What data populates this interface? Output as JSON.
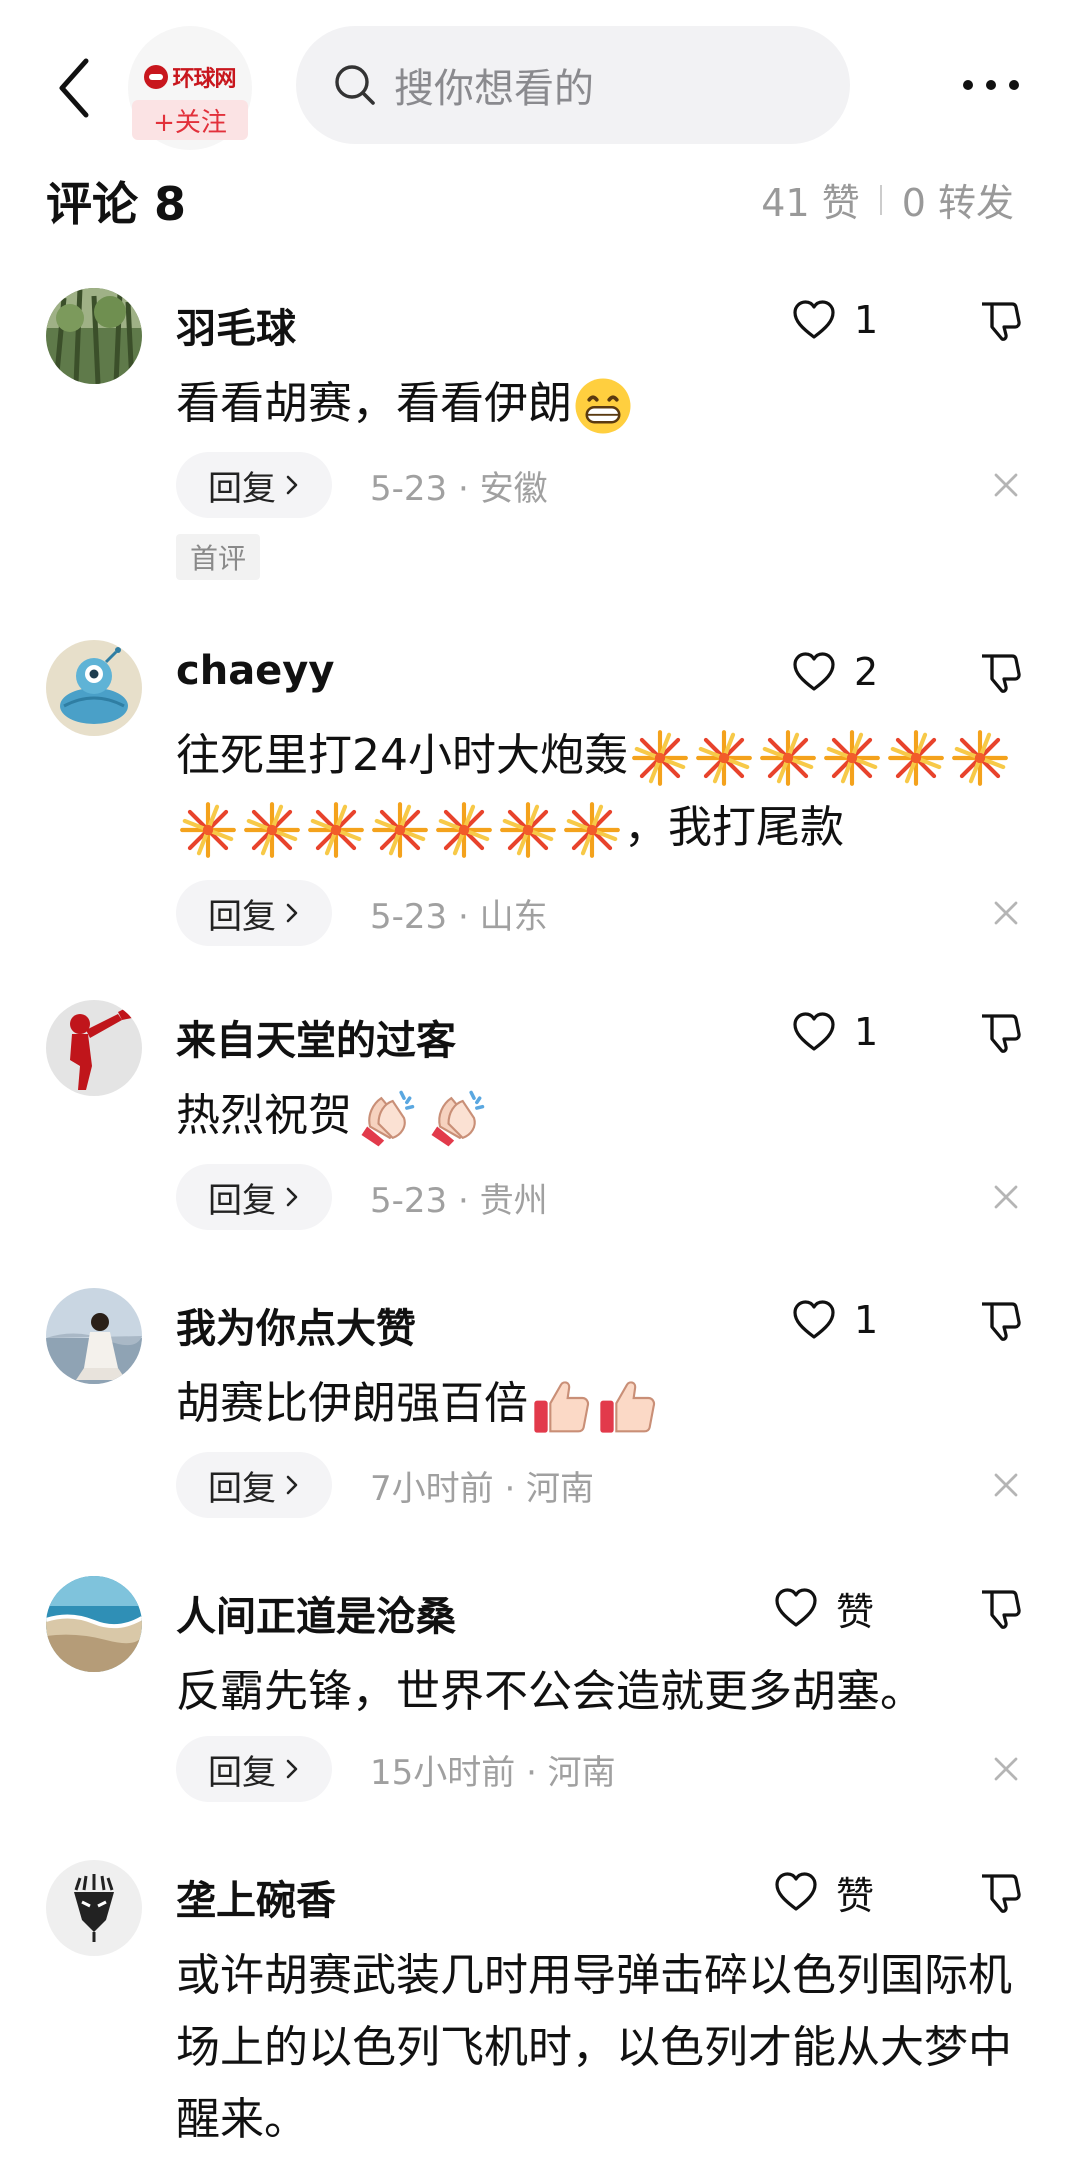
{
  "header": {
    "source_logo_text": "环球网",
    "follow_label": "+关注",
    "search_placeholder": "搜你想看的"
  },
  "comments_header": {
    "title": "评论 8",
    "likes": "41 赞",
    "reposts": "0 转发"
  },
  "comments": [
    {
      "username": "羽毛球",
      "likes": "1",
      "text": "看看胡赛，看看伊朗",
      "reply_label": "回复",
      "time_location": "5-23 · 安徽",
      "badge": "首评"
    },
    {
      "username": "chaeyy",
      "likes": "2",
      "text": "往死里打24小时大炮轰",
      "text_tail": "，我打尾款",
      "reply_label": "回复",
      "time_location": "5-23 · 山东"
    },
    {
      "username": "来自天堂的过客",
      "likes": "1",
      "text": "热烈祝贺",
      "reply_label": "回复",
      "time_location": "5-23 · 贵州"
    },
    {
      "username": "我为你点大赞",
      "likes": "1",
      "text": "胡赛比伊朗强百倍",
      "reply_label": "回复",
      "time_location": "7小时前 · 河南"
    },
    {
      "username": "人间正道是沧桑",
      "likes": "赞",
      "text": "反霸先锋，世界不公会造就更多胡塞。",
      "reply_label": "回复",
      "time_location": "15小时前 · 河南"
    },
    {
      "username": "垄上碗香",
      "likes": "赞",
      "text": "或许胡赛武装几时用导弹击碎以色列国际机场上的以色列飞机时，以色列才能从大梦中醒来。"
    }
  ],
  "icons": {
    "back": "chevron-left-icon",
    "search": "search-icon",
    "more": "more-dots-icon",
    "like": "heart-icon",
    "dislike": "thumbs-down-icon",
    "close": "close-icon",
    "emoji_grin": "grinning-face-emoji",
    "emoji_firework": "firework-emoji",
    "emoji_clap": "clapping-hands-emoji",
    "emoji_thumb": "thumbs-up-emoji"
  },
  "colors": {
    "accent_red": "#e2313b",
    "muted_text": "#999999",
    "reply_bg": "#f4f4f6"
  }
}
